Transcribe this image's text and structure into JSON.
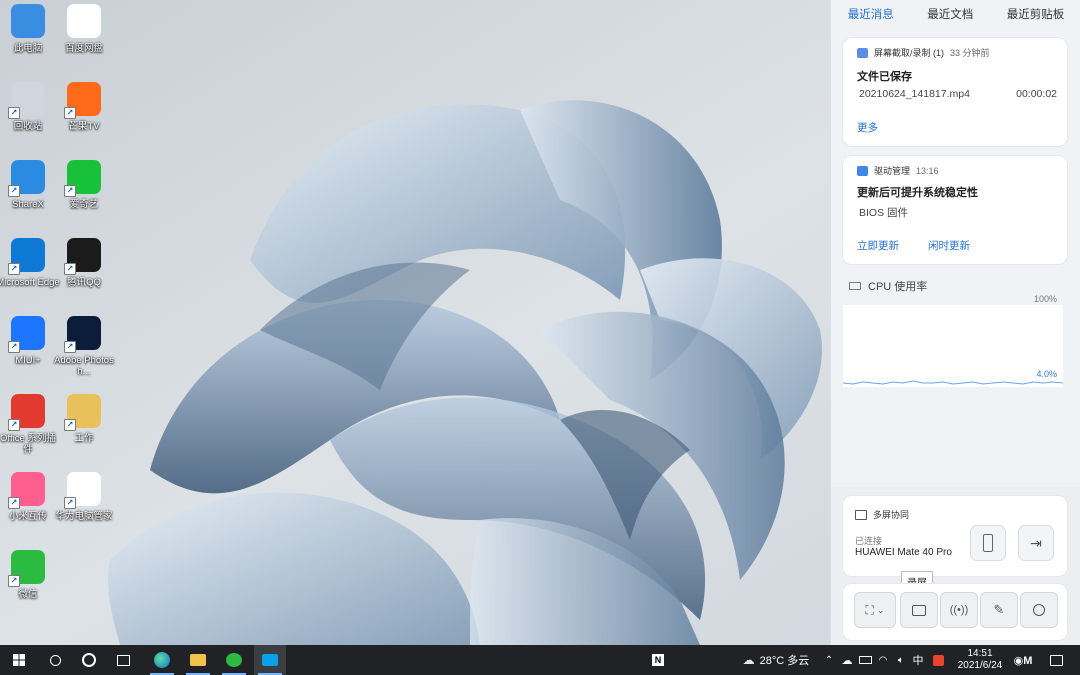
{
  "desktop": {
    "icons": [
      {
        "label": "此电脑",
        "icon": "computer-icon",
        "color": "#3a8de0"
      },
      {
        "label": "百度网盘",
        "icon": "baidu-netdisk-icon",
        "color": "#ffffff"
      },
      {
        "label": "回收站",
        "icon": "recycle-bin-icon",
        "color": "#cfd6de"
      },
      {
        "label": "芒果TV",
        "icon": "mango-tv-icon",
        "color": "#ff6a1a"
      },
      {
        "label": "ShareX",
        "icon": "sharex-icon",
        "color": "#2a8be0"
      },
      {
        "label": "爱奇艺",
        "icon": "iqiyi-icon",
        "color": "#18c13a"
      },
      {
        "label": "Microsoft Edge",
        "icon": "edge-icon",
        "color": "#0f7ad6"
      },
      {
        "label": "腾讯QQ",
        "icon": "qq-icon",
        "color": "#1b1b1b"
      },
      {
        "label": "MIUI+",
        "icon": "miui-plus-icon",
        "color": "#1c76ff"
      },
      {
        "label": "Adobe Photosh...",
        "icon": "photoshop-icon",
        "color": "#0b1d3a"
      },
      {
        "label": "Office 系列插件",
        "icon": "pdf-icon",
        "color": "#e23a2e"
      },
      {
        "label": "工作",
        "icon": "folder-icon",
        "color": "#e8c15a"
      },
      {
        "label": "小米互传",
        "icon": "xiaomi-share-icon",
        "color": "#ff5f8f"
      },
      {
        "label": "华为电脑管家",
        "icon": "huawei-pc-manager-icon",
        "color": "#ffffff"
      },
      {
        "label": "微信",
        "icon": "wechat-icon",
        "color": "#2bbb41"
      }
    ]
  },
  "panel": {
    "tabs": [
      "最近消息",
      "最近文档",
      "最近剪贴板"
    ],
    "notif1": {
      "source": "屏幕截取/录制 (1)",
      "time": "33 分钟前",
      "title": "文件已保存",
      "file": "20210624_141817.mp4",
      "duration": "00:00:02",
      "action": "更多"
    },
    "notif2": {
      "source": "驱动管理",
      "time": "13:16",
      "title": "更新后可提升系统稳定性",
      "item": "BIOS 固件",
      "action1": "立即更新",
      "action2": "闲时更新"
    },
    "cpu": {
      "title": "CPU 使用率",
      "max": "100%",
      "current": "4.0%"
    },
    "multiscreen": {
      "title": "多屏协同",
      "status": "已连接",
      "device": "HUAWEI Mate 40 Pro"
    },
    "tooltip": "录屏"
  },
  "taskbar": {
    "weather": "28°C 多云",
    "ime": "中",
    "time": "14:51",
    "date": "2021/6/24"
  }
}
